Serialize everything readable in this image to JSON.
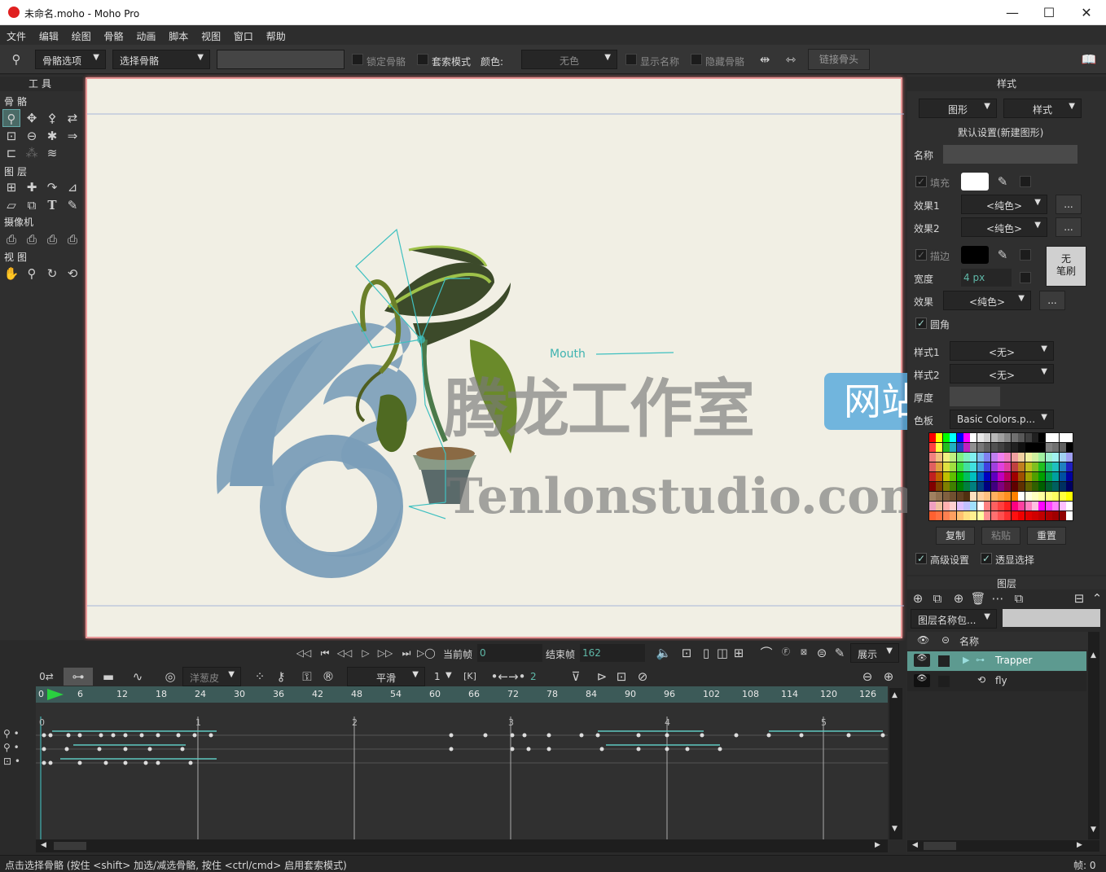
{
  "window": {
    "title": "未命名.moho - Moho Pro",
    "minimize": "—",
    "maximize": "☐",
    "close": "✕"
  },
  "menu": [
    "文件",
    "编辑",
    "绘图",
    "骨骼",
    "动画",
    "脚本",
    "视图",
    "窗口",
    "帮助"
  ],
  "toolbar": {
    "bone_options": "骨骼选项",
    "select_bone": "选择骨骼",
    "lock_bone": "锁定骨骼",
    "lasso_mode": "套索模式",
    "color_label": "颜色:",
    "color_value": "无色",
    "show_names": "显示名称",
    "hide_bones": "隐藏骨骼",
    "link_bones": "链接骨头"
  },
  "tools": {
    "header": "工具",
    "bone": "骨骼",
    "layer": "图层",
    "camera": "摄像机",
    "view": "视图"
  },
  "canvas": {
    "mouth_label": "Mouth"
  },
  "watermark": {
    "cn": "腾龙工作室",
    "site": "网站",
    "url": "Tenlonstudio.com"
  },
  "style_panel": {
    "header": "样式",
    "shape_dd": "图形",
    "style_dd": "样式",
    "default_label": "默认设置(新建图形)",
    "name_label": "名称",
    "fill_label": "填充",
    "effect1_label": "效果1",
    "effect1_value": "<纯色>",
    "effect2_label": "效果2",
    "effect2_value": "<纯色>",
    "stroke_label": "描边",
    "no_brush": "无\n笔刷",
    "width_label": "宽度",
    "width_value": "4 px",
    "effect_label": "效果",
    "effect_value": "<纯色>",
    "round_label": "圆角",
    "style1_label": "样式1",
    "style1_value": "<无>",
    "style2_label": "样式2",
    "style2_value": "<无>",
    "thickness_label": "厚度",
    "palette_label": "色板",
    "palette_value": "Basic Colors.p...",
    "copy": "复制",
    "paste": "粘贴",
    "reset": "重置",
    "advanced": "高级设置",
    "transparent_select": "透显选择",
    "more": "..."
  },
  "layers": {
    "header": "图层",
    "filter_dd": "图层名称包...",
    "col_name": "名称",
    "rows": [
      {
        "name": "Trapper",
        "selected": true
      },
      {
        "name": "fly",
        "selected": false
      }
    ]
  },
  "transport": {
    "current_frame_label": "当前帧",
    "current_frame": "0",
    "end_frame_label": "结束帧",
    "end_frame": "162",
    "display": "展示"
  },
  "timeline": {
    "onion": "洋葱皮",
    "smooth": "平滑",
    "interp_num": "1",
    "step_num": "2",
    "ruler": [
      "0",
      "6",
      "12",
      "18",
      "24",
      "30",
      "36",
      "42",
      "48",
      "54",
      "60",
      "66",
      "72",
      "78",
      "84",
      "90",
      "96",
      "102",
      "108",
      "114",
      "120",
      "126"
    ],
    "seconds": [
      "0",
      "1",
      "2",
      "3",
      "4",
      "5"
    ]
  },
  "status": {
    "hint": "点击选择骨骼 (按住 <shift> 加选/减选骨骼, 按住 <ctrl/cmd> 启用套索模式)",
    "frame": "帧: 0"
  },
  "colors": {
    "accent": "#5fb8a8",
    "canvas_bg": "#f1efe4",
    "selected_row": "#5d9a90"
  }
}
